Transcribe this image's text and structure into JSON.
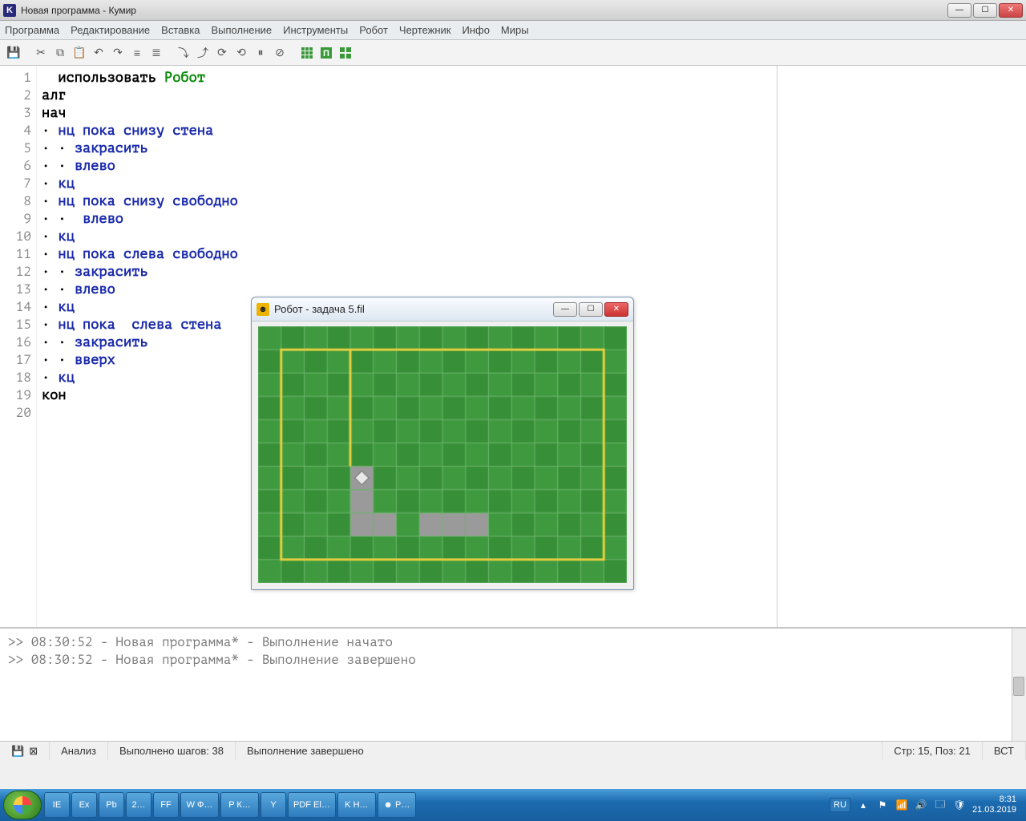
{
  "window": {
    "title": "Новая программа - Кумир",
    "app_icon_letter": "K"
  },
  "menus": [
    "Программа",
    "Редактирование",
    "Вставка",
    "Выполнение",
    "Инструменты",
    "Робот",
    "Чертежник",
    "Инфо",
    "Миры"
  ],
  "code": {
    "lines": [
      {
        "n": "1",
        "segs": [
          {
            "t": "  "
          },
          {
            "t": "использовать ",
            "c": "kw"
          },
          {
            "t": "Робот",
            "c": "rob"
          }
        ]
      },
      {
        "n": "2",
        "segs": [
          {
            "t": "алг",
            "c": "kw"
          }
        ]
      },
      {
        "n": "3",
        "segs": [
          {
            "t": "нач",
            "c": "kw"
          }
        ]
      },
      {
        "n": "4",
        "segs": [
          {
            "t": "· ",
            "c": "dot"
          },
          {
            "t": "нц пока ",
            "c": "bkw"
          },
          {
            "t": "снизу стена",
            "c": "bkw"
          }
        ]
      },
      {
        "n": "5",
        "segs": [
          {
            "t": "· · ",
            "c": "dot"
          },
          {
            "t": "закрасить",
            "c": "bkw"
          }
        ]
      },
      {
        "n": "6",
        "segs": [
          {
            "t": "· · ",
            "c": "dot"
          },
          {
            "t": "влево",
            "c": "bkw"
          }
        ]
      },
      {
        "n": "7",
        "segs": [
          {
            "t": "· ",
            "c": "dot"
          },
          {
            "t": "кц",
            "c": "bkw"
          }
        ]
      },
      {
        "n": "8",
        "segs": [
          {
            "t": "· ",
            "c": "dot"
          },
          {
            "t": "нц пока ",
            "c": "bkw"
          },
          {
            "t": "снизу свободно",
            "c": "bkw"
          }
        ]
      },
      {
        "n": "9",
        "segs": [
          {
            "t": "· ·  ",
            "c": "dot"
          },
          {
            "t": "влево",
            "c": "bkw"
          }
        ]
      },
      {
        "n": "10",
        "segs": [
          {
            "t": "· ",
            "c": "dot"
          },
          {
            "t": "кц",
            "c": "bkw"
          }
        ]
      },
      {
        "n": "11",
        "segs": [
          {
            "t": "· ",
            "c": "dot"
          },
          {
            "t": "нц пока ",
            "c": "bkw"
          },
          {
            "t": "слева свободно",
            "c": "bkw"
          }
        ]
      },
      {
        "n": "12",
        "segs": [
          {
            "t": "· · ",
            "c": "dot"
          },
          {
            "t": "закрасить",
            "c": "bkw"
          }
        ]
      },
      {
        "n": "13",
        "segs": [
          {
            "t": "· · ",
            "c": "dot"
          },
          {
            "t": "влево",
            "c": "bkw"
          }
        ]
      },
      {
        "n": "14",
        "segs": [
          {
            "t": "· ",
            "c": "dot"
          },
          {
            "t": "кц",
            "c": "bkw"
          }
        ]
      },
      {
        "n": "15",
        "segs": [
          {
            "t": "· ",
            "c": "dot"
          },
          {
            "t": "нц пока  ",
            "c": "bkw"
          },
          {
            "t": "слева стена",
            "c": "bkw"
          }
        ]
      },
      {
        "n": "16",
        "segs": [
          {
            "t": "· · ",
            "c": "dot"
          },
          {
            "t": "закрасить",
            "c": "bkw"
          }
        ]
      },
      {
        "n": "17",
        "segs": [
          {
            "t": "· · ",
            "c": "dot"
          },
          {
            "t": "вверх",
            "c": "bkw"
          }
        ]
      },
      {
        "n": "18",
        "segs": [
          {
            "t": "· ",
            "c": "dot"
          },
          {
            "t": "кц",
            "c": "bkw"
          }
        ]
      },
      {
        "n": "19",
        "segs": [
          {
            "t": "кон",
            "c": "kw"
          }
        ]
      },
      {
        "n": "20",
        "segs": [
          {
            "t": ""
          }
        ]
      }
    ]
  },
  "robot_window": {
    "title": "Робот - задача 5.fil",
    "grid": {
      "cols": 16,
      "rows": 11,
      "painted": [
        [
          4,
          6
        ],
        [
          4,
          7
        ],
        [
          4,
          8
        ],
        [
          5,
          8
        ],
        [
          7,
          8
        ],
        [
          8,
          8
        ],
        [
          9,
          8
        ]
      ],
      "robot": [
        4,
        6
      ],
      "border_inset": {
        "left": 1,
        "top": 1,
        "right": 1,
        "bottom": 1
      },
      "divider_col_right_of": 3,
      "divider_from_row": 1,
      "divider_to_row": 5
    }
  },
  "console": {
    "lines": [
      ">> 08:30:52 - Новая программа* - Выполнение начато",
      ">> 08:30:52 - Новая программа* - Выполнение завершено"
    ]
  },
  "status": {
    "analysis": "Анализ",
    "steps": "Выполнено шагов: 38",
    "exec": "Выполнение завершено",
    "pos": "Стр: 15, Поз: 21",
    "mode": "ВСТ"
  },
  "taskbar": {
    "items": [
      "IE",
      "Ex",
      "Pb",
      "2…",
      "FF",
      "W Ф…",
      "P К…",
      "Y",
      "PDF El…",
      "K Н…",
      "☻ Р…"
    ],
    "lang": "RU",
    "time": "8:31",
    "date": "21.03.2019"
  }
}
